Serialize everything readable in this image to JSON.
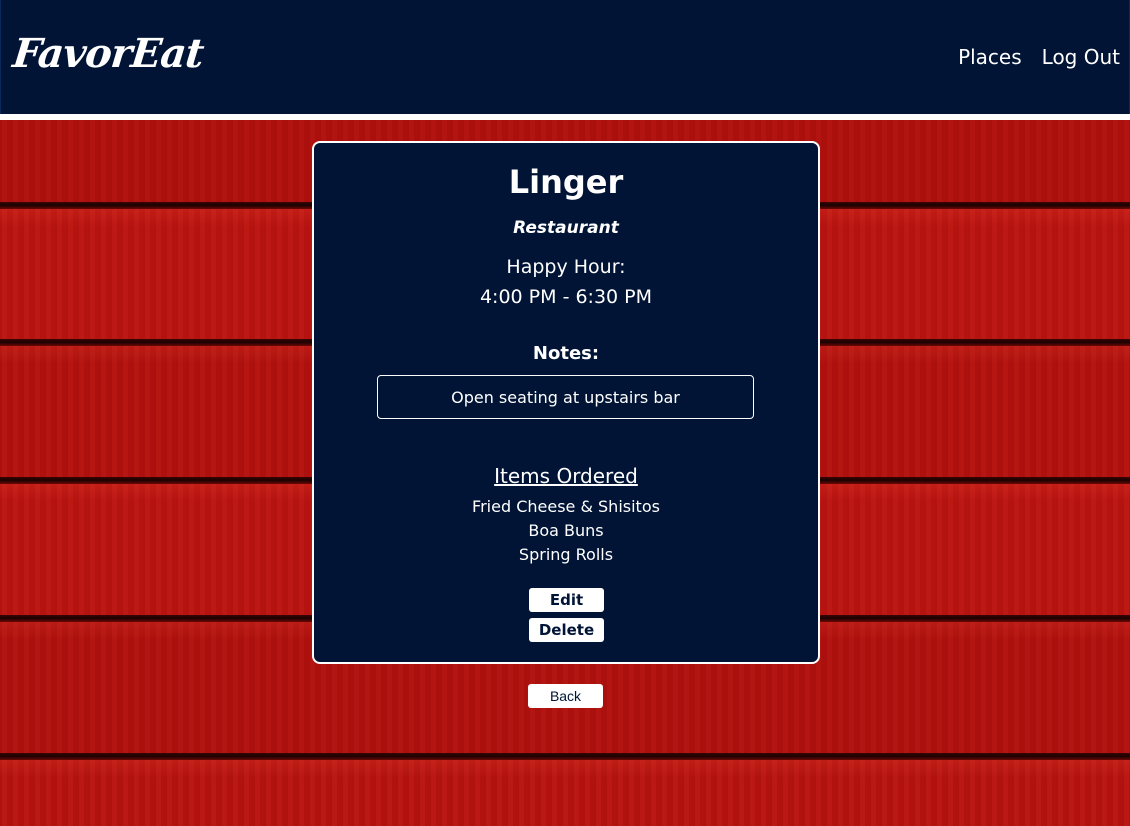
{
  "header": {
    "logo": "FavorEat",
    "nav": [
      {
        "label": "Places"
      },
      {
        "label": "Log Out"
      }
    ]
  },
  "place": {
    "name": "Linger",
    "type": "Restaurant",
    "happy_hour_label": "Happy Hour:",
    "happy_hour_time": "4:00 PM - 6:30 PM",
    "notes_title": "Notes:",
    "notes": "Open seating at upstairs bar",
    "items_title": "Items Ordered",
    "items": [
      "Fried Cheese & Shisitos",
      "Boa Buns",
      "Spring Rolls"
    ],
    "edit_label": "Edit",
    "delete_label": "Delete"
  },
  "back_label": "Back",
  "colors": {
    "navy": "#011435",
    "wood_red": "#b8130f",
    "white": "#ffffff"
  }
}
